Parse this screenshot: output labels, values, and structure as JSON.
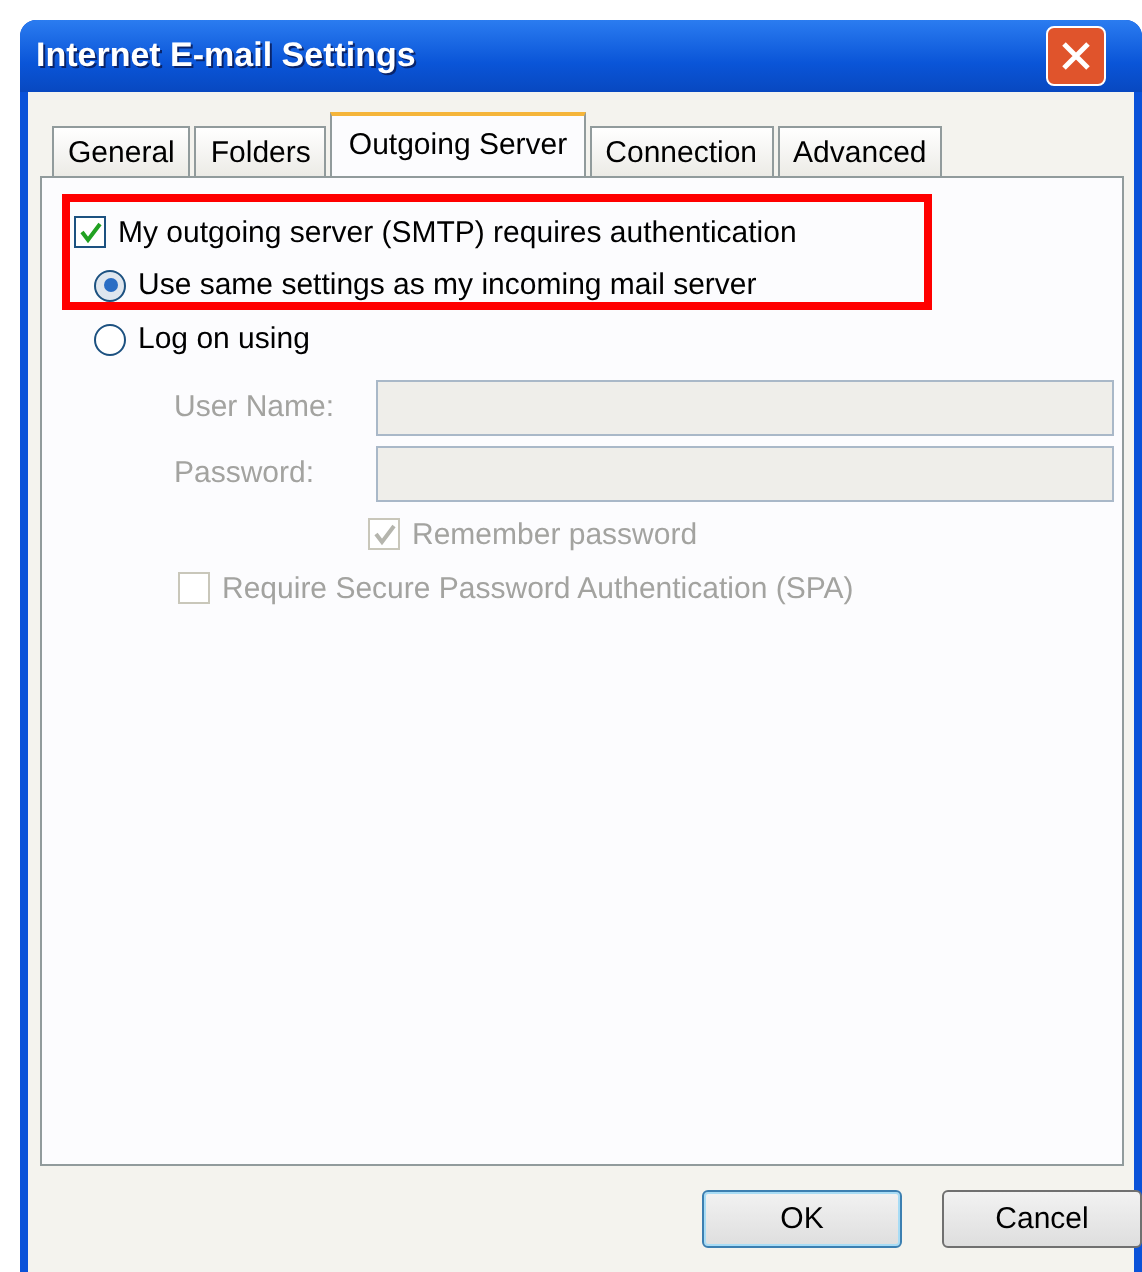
{
  "window": {
    "title": "Internet E-mail Settings"
  },
  "tabs": [
    {
      "label": "General",
      "selected": false
    },
    {
      "label": "Folders",
      "selected": false
    },
    {
      "label": "Outgoing Server",
      "selected": true
    },
    {
      "label": "Connection",
      "selected": false
    },
    {
      "label": "Advanced",
      "selected": false
    }
  ],
  "auth_checkbox": {
    "label": "My outgoing server (SMTP) requires authentication",
    "checked": true
  },
  "radios": [
    {
      "label": "Use same settings as my incoming mail server",
      "selected": true
    },
    {
      "label": "Log on using",
      "selected": false
    }
  ],
  "fields": [
    {
      "label": "User Name:",
      "disabled": true
    },
    {
      "label": "Password:",
      "disabled": true
    }
  ],
  "remember_checkbox": {
    "label": "Remember password",
    "checked": true,
    "disabled": true
  },
  "spa_checkbox": {
    "label": "Require Secure Password Authentication (SPA)",
    "checked": false,
    "disabled": true
  },
  "buttons": [
    {
      "label": "OK",
      "kind": "default"
    },
    {
      "label": "Cancel",
      "kind": "normal"
    }
  ]
}
